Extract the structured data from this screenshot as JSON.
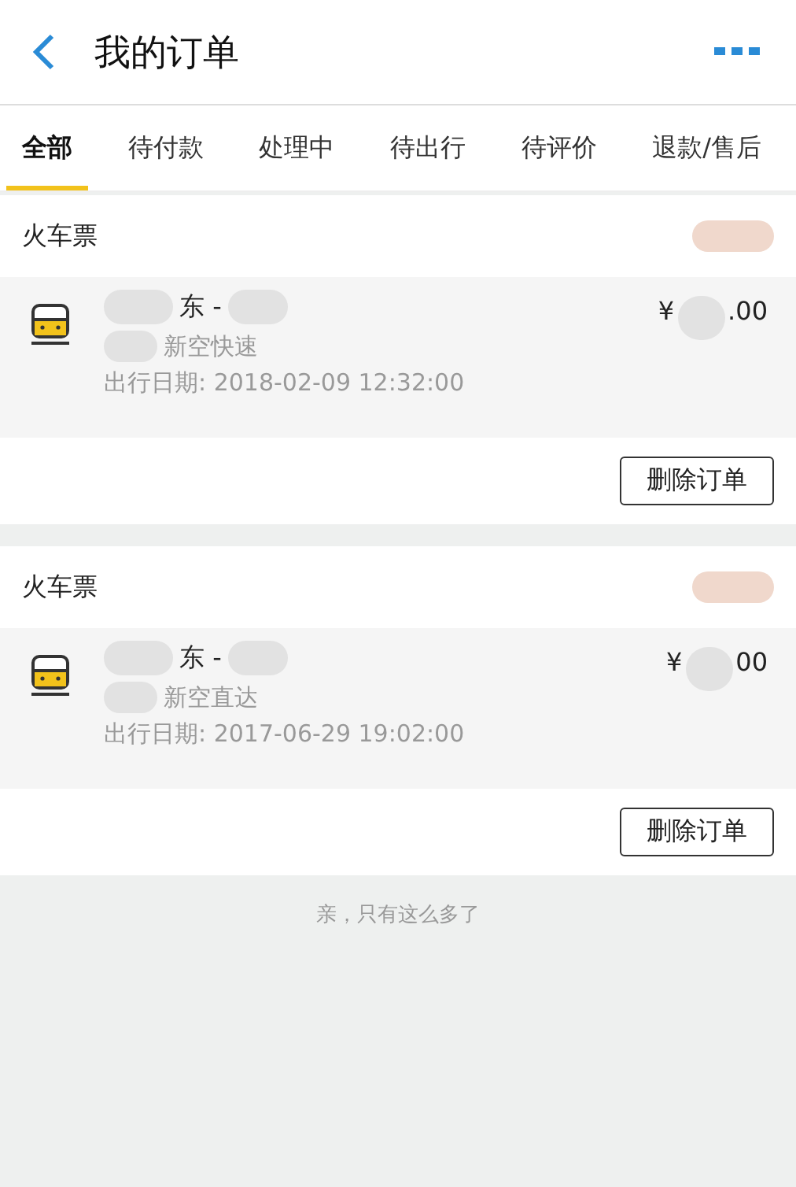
{
  "header": {
    "title": "我的订单"
  },
  "tabs": [
    {
      "label": "全部",
      "selected": true
    },
    {
      "label": "待付款",
      "selected": false
    },
    {
      "label": "处理中",
      "selected": false
    },
    {
      "label": "待出行",
      "selected": false
    },
    {
      "label": "待评价",
      "selected": false
    },
    {
      "label": "退款/售后",
      "selected": false
    }
  ],
  "orders": [
    {
      "category": "火车票",
      "route": "东 -",
      "train": "新空快速",
      "date": "出行日期: 2018-02-09 12:32:00",
      "price": "¥",
      "price_tail": ".00",
      "button": "删除订单"
    },
    {
      "category": "火车票",
      "route": "东 -",
      "train": "新空直达",
      "date": "出行日期: 2017-06-29 19:02:00",
      "price": "¥",
      "price_tail": "00",
      "button": "删除订单"
    }
  ],
  "footer": "亲，只有这么多了"
}
